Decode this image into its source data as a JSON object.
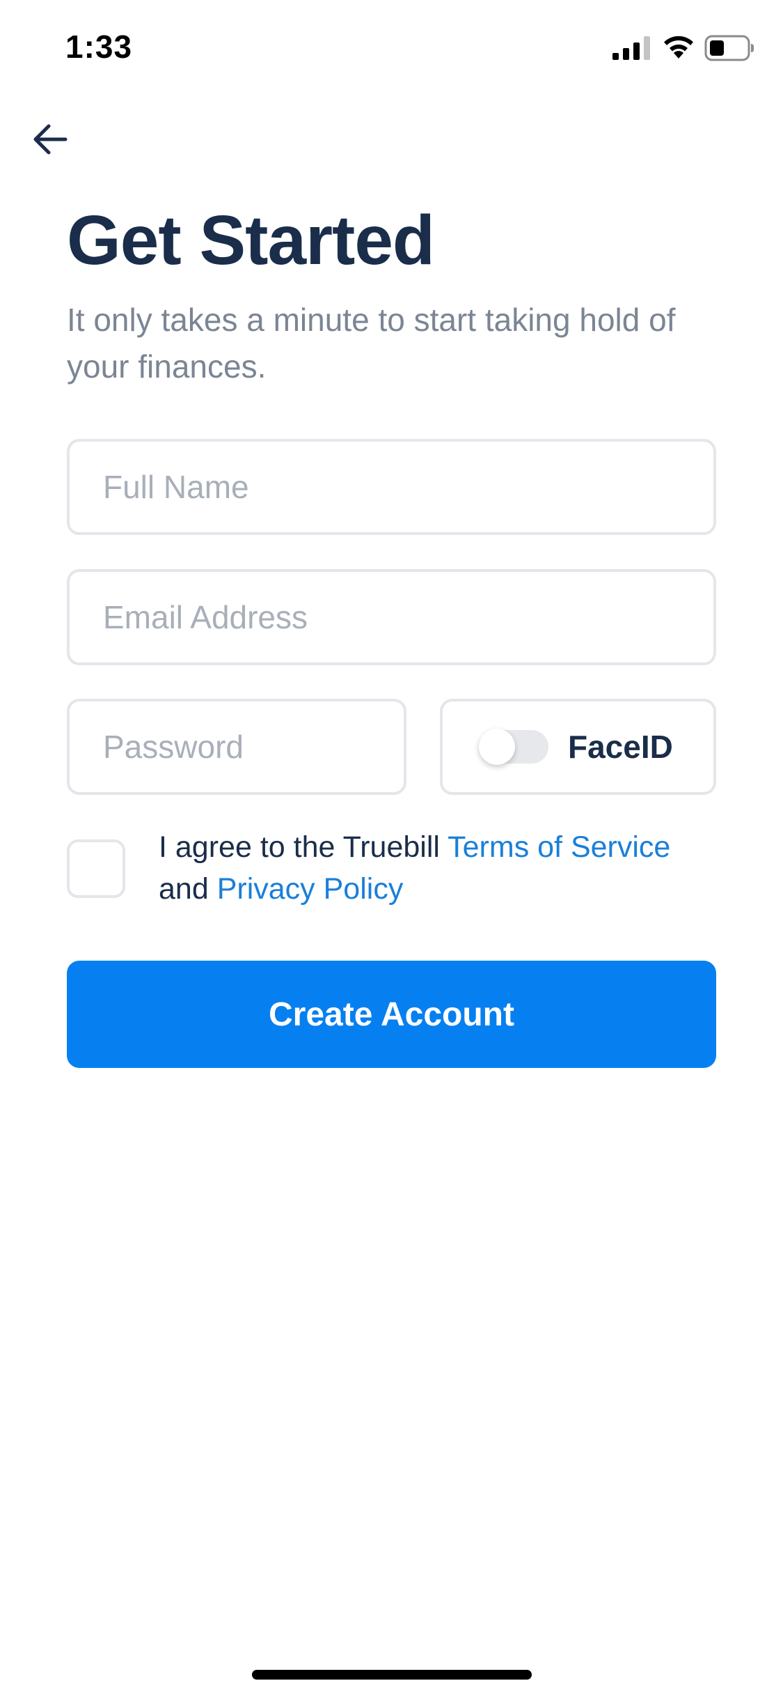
{
  "status_bar": {
    "time": "1:33",
    "signal_icon": "cellular-signal-icon",
    "wifi_icon": "wifi-icon",
    "battery_icon": "battery-icon"
  },
  "nav": {
    "back_icon": "arrow-left-icon"
  },
  "header": {
    "title": "Get Started",
    "subtitle": "It only takes a minute to start taking hold of your finances."
  },
  "form": {
    "full_name": {
      "value": "",
      "placeholder": "Full Name"
    },
    "email": {
      "value": "",
      "placeholder": "Email Address"
    },
    "password": {
      "value": "",
      "placeholder": "Password"
    },
    "faceid": {
      "label": "FaceID",
      "enabled": false
    }
  },
  "agreement": {
    "checked": false,
    "prefix": "I agree to the Truebill ",
    "terms_link": "Terms of Service",
    "middle": "and ",
    "privacy_link": "Privacy Policy"
  },
  "actions": {
    "create_account_label": "Create Account"
  },
  "colors": {
    "primary": "#0680f0",
    "title": "#1a2d4a",
    "subtitle": "#7b8594",
    "link": "#1a7fd9",
    "border": "#e3e6ea"
  }
}
